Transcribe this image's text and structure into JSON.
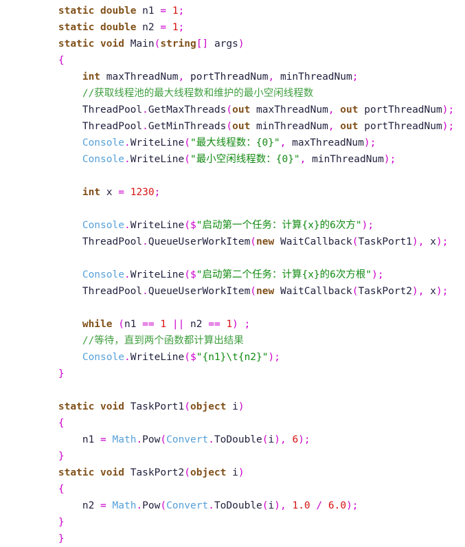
{
  "editor": {
    "language": "csharp",
    "background": "#ffffff",
    "indent_unit": "    ",
    "colors": {
      "keyword": "#80501a",
      "number": "#d81111",
      "punctuation": "#cc00cc",
      "string": "#128a12",
      "comment": "#3f9e3f",
      "class": "#56a0d8",
      "plain": "#1f1f3d"
    }
  },
  "lines": [
    {
      "indent": 1,
      "tokens": [
        {
          "t": "kw",
          "v": "static"
        },
        {
          "t": "plain",
          "v": " "
        },
        {
          "t": "kw",
          "v": "double"
        },
        {
          "t": "plain",
          "v": " n1 "
        },
        {
          "t": "punc",
          "v": "="
        },
        {
          "t": "plain",
          "v": " "
        },
        {
          "t": "num",
          "v": "1"
        },
        {
          "t": "punc",
          "v": ";"
        }
      ]
    },
    {
      "indent": 1,
      "tokens": [
        {
          "t": "kw",
          "v": "static"
        },
        {
          "t": "plain",
          "v": " "
        },
        {
          "t": "kw",
          "v": "double"
        },
        {
          "t": "plain",
          "v": " n2 "
        },
        {
          "t": "punc",
          "v": "="
        },
        {
          "t": "plain",
          "v": " "
        },
        {
          "t": "num",
          "v": "1"
        },
        {
          "t": "punc",
          "v": ";"
        }
      ]
    },
    {
      "indent": 1,
      "tokens": [
        {
          "t": "kw",
          "v": "static"
        },
        {
          "t": "plain",
          "v": " "
        },
        {
          "t": "kw",
          "v": "void"
        },
        {
          "t": "plain",
          "v": " Main"
        },
        {
          "t": "punc",
          "v": "("
        },
        {
          "t": "kw",
          "v": "string"
        },
        {
          "t": "punc",
          "v": "[]"
        },
        {
          "t": "plain",
          "v": " args"
        },
        {
          "t": "punc",
          "v": ")"
        }
      ]
    },
    {
      "indent": 1,
      "tokens": [
        {
          "t": "punc",
          "v": "{"
        }
      ]
    },
    {
      "indent": 2,
      "tokens": [
        {
          "t": "kw",
          "v": "int"
        },
        {
          "t": "plain",
          "v": " maxThreadNum"
        },
        {
          "t": "punc",
          "v": ","
        },
        {
          "t": "plain",
          "v": " portThreadNum"
        },
        {
          "t": "punc",
          "v": ","
        },
        {
          "t": "plain",
          "v": " minThreadNum"
        },
        {
          "t": "punc",
          "v": ";"
        }
      ]
    },
    {
      "indent": 2,
      "tokens": [
        {
          "t": "cmt",
          "v": "//获取线程池的最大线程数和维护的最小空闲线程数"
        }
      ]
    },
    {
      "indent": 2,
      "tokens": [
        {
          "t": "plain",
          "v": "ThreadPool"
        },
        {
          "t": "punc",
          "v": "."
        },
        {
          "t": "plain",
          "v": "GetMaxThreads"
        },
        {
          "t": "punc",
          "v": "("
        },
        {
          "t": "kw",
          "v": "out"
        },
        {
          "t": "plain",
          "v": " maxThreadNum"
        },
        {
          "t": "punc",
          "v": ","
        },
        {
          "t": "plain",
          "v": " "
        },
        {
          "t": "kw",
          "v": "out"
        },
        {
          "t": "plain",
          "v": " portThreadNum"
        },
        {
          "t": "punc",
          "v": ");"
        }
      ]
    },
    {
      "indent": 2,
      "tokens": [
        {
          "t": "plain",
          "v": "ThreadPool"
        },
        {
          "t": "punc",
          "v": "."
        },
        {
          "t": "plain",
          "v": "GetMinThreads"
        },
        {
          "t": "punc",
          "v": "("
        },
        {
          "t": "kw",
          "v": "out"
        },
        {
          "t": "plain",
          "v": " minThreadNum"
        },
        {
          "t": "punc",
          "v": ","
        },
        {
          "t": "plain",
          "v": " "
        },
        {
          "t": "kw",
          "v": "out"
        },
        {
          "t": "plain",
          "v": " portThreadNum"
        },
        {
          "t": "punc",
          "v": ");"
        }
      ]
    },
    {
      "indent": 2,
      "tokens": [
        {
          "t": "class",
          "v": "Console"
        },
        {
          "t": "punc",
          "v": "."
        },
        {
          "t": "plain",
          "v": "WriteLine"
        },
        {
          "t": "punc",
          "v": "("
        },
        {
          "t": "str",
          "v": "\"最大线程数：{0}\""
        },
        {
          "t": "punc",
          "v": ","
        },
        {
          "t": "plain",
          "v": " maxThreadNum"
        },
        {
          "t": "punc",
          "v": ");"
        }
      ]
    },
    {
      "indent": 2,
      "tokens": [
        {
          "t": "class",
          "v": "Console"
        },
        {
          "t": "punc",
          "v": "."
        },
        {
          "t": "plain",
          "v": "WriteLine"
        },
        {
          "t": "punc",
          "v": "("
        },
        {
          "t": "str",
          "v": "\"最小空闲线程数：{0}\""
        },
        {
          "t": "punc",
          "v": ","
        },
        {
          "t": "plain",
          "v": " minThreadNum"
        },
        {
          "t": "punc",
          "v": ");"
        }
      ]
    },
    {
      "indent": 0,
      "tokens": []
    },
    {
      "indent": 2,
      "tokens": [
        {
          "t": "kw",
          "v": "int"
        },
        {
          "t": "plain",
          "v": " x "
        },
        {
          "t": "punc",
          "v": "="
        },
        {
          "t": "plain",
          "v": " "
        },
        {
          "t": "num",
          "v": "1230"
        },
        {
          "t": "punc",
          "v": ";"
        }
      ]
    },
    {
      "indent": 0,
      "tokens": []
    },
    {
      "indent": 2,
      "tokens": [
        {
          "t": "class",
          "v": "Console"
        },
        {
          "t": "punc",
          "v": "."
        },
        {
          "t": "plain",
          "v": "WriteLine"
        },
        {
          "t": "punc",
          "v": "("
        },
        {
          "t": "punc",
          "v": "$"
        },
        {
          "t": "str",
          "v": "\"启动第一个任务：计算{x}的6次方\""
        },
        {
          "t": "punc",
          "v": ");"
        }
      ]
    },
    {
      "indent": 2,
      "tokens": [
        {
          "t": "plain",
          "v": "ThreadPool"
        },
        {
          "t": "punc",
          "v": "."
        },
        {
          "t": "plain",
          "v": "QueueUserWorkItem"
        },
        {
          "t": "punc",
          "v": "("
        },
        {
          "t": "kw",
          "v": "new"
        },
        {
          "t": "plain",
          "v": " WaitCallback"
        },
        {
          "t": "punc",
          "v": "("
        },
        {
          "t": "plain",
          "v": "TaskPort1"
        },
        {
          "t": "punc",
          "v": "),"
        },
        {
          "t": "plain",
          "v": " x"
        },
        {
          "t": "punc",
          "v": ");"
        }
      ]
    },
    {
      "indent": 0,
      "tokens": []
    },
    {
      "indent": 2,
      "tokens": [
        {
          "t": "class",
          "v": "Console"
        },
        {
          "t": "punc",
          "v": "."
        },
        {
          "t": "plain",
          "v": "WriteLine"
        },
        {
          "t": "punc",
          "v": "("
        },
        {
          "t": "punc",
          "v": "$"
        },
        {
          "t": "str",
          "v": "\"启动第二个任务：计算{x}的6次方根\""
        },
        {
          "t": "punc",
          "v": ");"
        }
      ]
    },
    {
      "indent": 2,
      "tokens": [
        {
          "t": "plain",
          "v": "ThreadPool"
        },
        {
          "t": "punc",
          "v": "."
        },
        {
          "t": "plain",
          "v": "QueueUserWorkItem"
        },
        {
          "t": "punc",
          "v": "("
        },
        {
          "t": "kw",
          "v": "new"
        },
        {
          "t": "plain",
          "v": " WaitCallback"
        },
        {
          "t": "punc",
          "v": "("
        },
        {
          "t": "plain",
          "v": "TaskPort2"
        },
        {
          "t": "punc",
          "v": "),"
        },
        {
          "t": "plain",
          "v": " x"
        },
        {
          "t": "punc",
          "v": ");"
        }
      ]
    },
    {
      "indent": 0,
      "tokens": []
    },
    {
      "indent": 2,
      "tokens": [
        {
          "t": "kw",
          "v": "while"
        },
        {
          "t": "plain",
          "v": " "
        },
        {
          "t": "punc",
          "v": "("
        },
        {
          "t": "plain",
          "v": "n1 "
        },
        {
          "t": "punc",
          "v": "=="
        },
        {
          "t": "plain",
          "v": " "
        },
        {
          "t": "num",
          "v": "1"
        },
        {
          "t": "plain",
          "v": " "
        },
        {
          "t": "punc",
          "v": "||"
        },
        {
          "t": "plain",
          "v": " n2 "
        },
        {
          "t": "punc",
          "v": "=="
        },
        {
          "t": "plain",
          "v": " "
        },
        {
          "t": "num",
          "v": "1"
        },
        {
          "t": "punc",
          "v": ")"
        },
        {
          "t": "plain",
          "v": " "
        },
        {
          "t": "punc",
          "v": ";"
        }
      ]
    },
    {
      "indent": 2,
      "tokens": [
        {
          "t": "cmt",
          "v": "//等待，直到两个函数都计算出结果"
        }
      ]
    },
    {
      "indent": 2,
      "tokens": [
        {
          "t": "class",
          "v": "Console"
        },
        {
          "t": "punc",
          "v": "."
        },
        {
          "t": "plain",
          "v": "WriteLine"
        },
        {
          "t": "punc",
          "v": "("
        },
        {
          "t": "punc",
          "v": "$"
        },
        {
          "t": "str",
          "v": "\"{n1}\\t{n2}\""
        },
        {
          "t": "punc",
          "v": ");"
        }
      ]
    },
    {
      "indent": 1,
      "tokens": [
        {
          "t": "punc",
          "v": "}"
        }
      ]
    },
    {
      "indent": 0,
      "tokens": []
    },
    {
      "indent": 1,
      "tokens": [
        {
          "t": "kw",
          "v": "static"
        },
        {
          "t": "plain",
          "v": " "
        },
        {
          "t": "kw",
          "v": "void"
        },
        {
          "t": "plain",
          "v": " TaskPort1"
        },
        {
          "t": "punc",
          "v": "("
        },
        {
          "t": "kw",
          "v": "object"
        },
        {
          "t": "plain",
          "v": " i"
        },
        {
          "t": "punc",
          "v": ")"
        }
      ]
    },
    {
      "indent": 1,
      "tokens": [
        {
          "t": "punc",
          "v": "{"
        }
      ]
    },
    {
      "indent": 2,
      "tokens": [
        {
          "t": "plain",
          "v": "n1 "
        },
        {
          "t": "punc",
          "v": "="
        },
        {
          "t": "plain",
          "v": " "
        },
        {
          "t": "class",
          "v": "Math"
        },
        {
          "t": "punc",
          "v": "."
        },
        {
          "t": "plain",
          "v": "Pow"
        },
        {
          "t": "punc",
          "v": "("
        },
        {
          "t": "class",
          "v": "Convert"
        },
        {
          "t": "punc",
          "v": "."
        },
        {
          "t": "plain",
          "v": "ToDouble"
        },
        {
          "t": "punc",
          "v": "("
        },
        {
          "t": "plain",
          "v": "i"
        },
        {
          "t": "punc",
          "v": "),"
        },
        {
          "t": "plain",
          "v": " "
        },
        {
          "t": "num",
          "v": "6"
        },
        {
          "t": "punc",
          "v": ");"
        }
      ]
    },
    {
      "indent": 1,
      "tokens": [
        {
          "t": "punc",
          "v": "}"
        }
      ]
    },
    {
      "indent": 1,
      "tokens": [
        {
          "t": "kw",
          "v": "static"
        },
        {
          "t": "plain",
          "v": " "
        },
        {
          "t": "kw",
          "v": "void"
        },
        {
          "t": "plain",
          "v": " TaskPort2"
        },
        {
          "t": "punc",
          "v": "("
        },
        {
          "t": "kw",
          "v": "object"
        },
        {
          "t": "plain",
          "v": " i"
        },
        {
          "t": "punc",
          "v": ")"
        }
      ]
    },
    {
      "indent": 1,
      "tokens": [
        {
          "t": "punc",
          "v": "{"
        }
      ]
    },
    {
      "indent": 2,
      "tokens": [
        {
          "t": "plain",
          "v": "n2 "
        },
        {
          "t": "punc",
          "v": "="
        },
        {
          "t": "plain",
          "v": " "
        },
        {
          "t": "class",
          "v": "Math"
        },
        {
          "t": "punc",
          "v": "."
        },
        {
          "t": "plain",
          "v": "Pow"
        },
        {
          "t": "punc",
          "v": "("
        },
        {
          "t": "class",
          "v": "Convert"
        },
        {
          "t": "punc",
          "v": "."
        },
        {
          "t": "plain",
          "v": "ToDouble"
        },
        {
          "t": "punc",
          "v": "("
        },
        {
          "t": "plain",
          "v": "i"
        },
        {
          "t": "punc",
          "v": "),"
        },
        {
          "t": "plain",
          "v": " "
        },
        {
          "t": "num",
          "v": "1.0"
        },
        {
          "t": "plain",
          "v": " "
        },
        {
          "t": "punc",
          "v": "/"
        },
        {
          "t": "plain",
          "v": " "
        },
        {
          "t": "num",
          "v": "6.0"
        },
        {
          "t": "punc",
          "v": ");"
        }
      ]
    },
    {
      "indent": 1,
      "tokens": [
        {
          "t": "punc",
          "v": "}"
        }
      ]
    },
    {
      "indent": 1,
      "tokens": [
        {
          "t": "punc",
          "v": "}"
        }
      ]
    }
  ]
}
